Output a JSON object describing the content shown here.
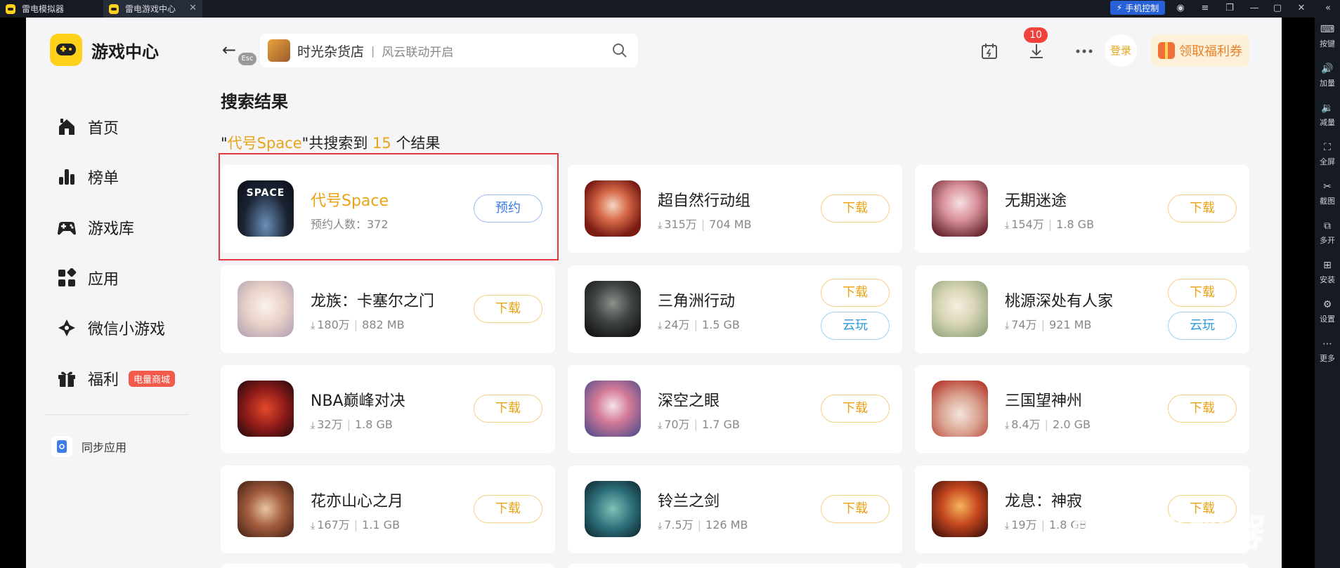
{
  "titlebar": {
    "tabs": [
      {
        "label": "雷电模拟器"
      },
      {
        "label": "雷电游戏中心"
      }
    ],
    "phone_control": "手机控制"
  },
  "rightbar": [
    {
      "label": "按键",
      "icon": "keyboard-icon"
    },
    {
      "label": "加量",
      "icon": "volume-up-icon"
    },
    {
      "label": "减量",
      "icon": "volume-down-icon"
    },
    {
      "label": "全屏",
      "icon": "fullscreen-icon"
    },
    {
      "label": "截图",
      "icon": "screenshot-icon"
    },
    {
      "label": "多开",
      "icon": "multi-instance-icon"
    },
    {
      "label": "安装",
      "icon": "install-icon"
    },
    {
      "label": "设置",
      "icon": "settings-icon"
    },
    {
      "label": "更多",
      "icon": "more-icon"
    }
  ],
  "sidebar": {
    "brand": "游戏中心",
    "items": [
      {
        "label": "首页",
        "icon": "home-icon"
      },
      {
        "label": "榜单",
        "icon": "ranking-icon"
      },
      {
        "label": "游戏库",
        "icon": "gamepad-icon"
      },
      {
        "label": "应用",
        "icon": "apps-icon"
      },
      {
        "label": "微信小游戏",
        "icon": "wechat-game-icon"
      },
      {
        "label": "福利",
        "icon": "gift-icon",
        "badge": "电量商城"
      }
    ],
    "sync": "同步应用"
  },
  "header": {
    "esc": "Esc",
    "search_title": "时光杂货店",
    "search_sep": "|",
    "search_hint": "风云联动开启",
    "download_count": "10",
    "login": "登录",
    "coupon": "领取福利券"
  },
  "results": {
    "title": "搜索结果",
    "quote_open": "\"",
    "query": "代号Space",
    "quote_close": "\"",
    "prefix": "共搜索到",
    "count": "15",
    "suffix": "个结果"
  },
  "games": [
    {
      "name": "代号Space",
      "meta_label": "预约人数：372",
      "btn": "预约"
    },
    {
      "name": "超自然行动组",
      "downloads": "315万",
      "size": "704 MB",
      "btn": "下载"
    },
    {
      "name": "无期迷途",
      "downloads": "154万",
      "size": "1.8 GB",
      "btn": "下载"
    },
    {
      "name": "龙族：卡塞尔之门",
      "downloads": "180万",
      "size": "882 MB",
      "btn": "下载"
    },
    {
      "name": "三角洲行动",
      "downloads": "24万",
      "size": "1.5 GB",
      "btn": "下载",
      "btn2": "云玩"
    },
    {
      "name": "桃源深处有人家",
      "downloads": "74万",
      "size": "921 MB",
      "btn": "下载",
      "btn2": "云玩"
    },
    {
      "name": "NBA巅峰对决",
      "downloads": "32万",
      "size": "1.8 GB",
      "btn": "下载"
    },
    {
      "name": "深空之眼",
      "downloads": "70万",
      "size": "1.7 GB",
      "btn": "下载"
    },
    {
      "name": "三国望神州",
      "downloads": "8.4万",
      "size": "2.0 GB",
      "btn": "下载"
    },
    {
      "name": "花亦山心之月",
      "downloads": "167万",
      "size": "1.1 GB",
      "btn": "下载"
    },
    {
      "name": "铃兰之剑",
      "downloads": "7.5万",
      "size": "126 MB",
      "btn": "下载"
    },
    {
      "name": "龙息：神寂",
      "downloads": "19万",
      "size": "1.8 GB",
      "btn": "下载"
    }
  ],
  "icons": {
    "download_arrow": "⤓"
  },
  "watermark": "雷电模拟器",
  "colors": {
    "accent": "#e8a317",
    "reserve_blue": "#3d7ae6",
    "cloud_blue": "#2b9be0",
    "highlight_red": "#e0393e"
  }
}
